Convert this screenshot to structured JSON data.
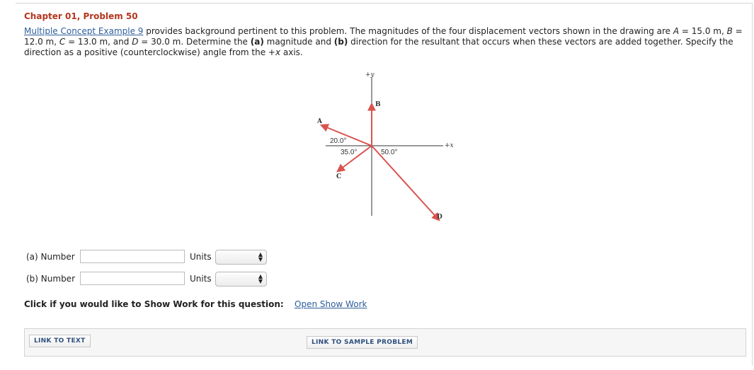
{
  "header": {
    "title": "Chapter 01, Problem 50"
  },
  "problem": {
    "link_text": "Multiple Concept Example 9",
    "text_1": " provides background pertinent to this problem. The magnitudes of the four displacement vectors shown in the drawing are ",
    "a_var": "A",
    "a_val": " = 15.0 m, ",
    "b_var": "B",
    "b_val": " = 12.0 m, ",
    "c_var": "C",
    "c_val": " = 13.0 m, and ",
    "d_var": "D",
    "d_val": " = 30.0 m. Determine the ",
    "part_a": "(a)",
    "text_2": " magnitude and ",
    "part_b": "(b)",
    "text_3": " direction for the resultant that occurs when these vectors are added together. Specify the direction as a positive (counterclockwise) angle from the ",
    "axis": "+x",
    "text_4": " axis."
  },
  "diagram": {
    "axis_y": "+y",
    "axis_x": "+x",
    "vec_a": "A",
    "vec_b": "B",
    "vec_c": "C",
    "vec_d": "D",
    "angle_a": "20.0°",
    "angle_c": "35.0°",
    "angle_d": "50.0°",
    "colors": {
      "vector": "#d9534f",
      "axis": "#333333"
    }
  },
  "answers": {
    "a_label": "(a) Number",
    "b_label": "(b) Number",
    "units_label": "Units",
    "a_value": "",
    "b_value": ""
  },
  "showwork": {
    "prompt": "Click if you would like to Show Work for this question:",
    "link": "Open Show Work"
  },
  "links": {
    "to_text": "LINK TO TEXT",
    "to_sample": "LINK TO SAMPLE PROBLEM"
  }
}
